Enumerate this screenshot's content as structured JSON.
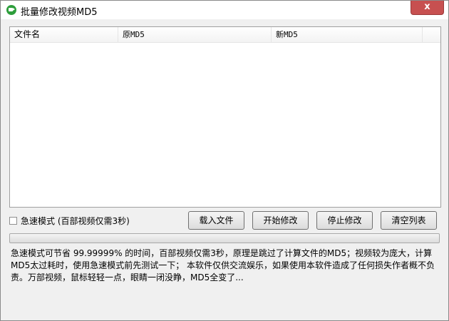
{
  "window": {
    "title": "批量修改视频MD5",
    "close_label": "x"
  },
  "list": {
    "columns": [
      "文件名",
      "原MD5",
      "新MD5",
      ""
    ]
  },
  "fast_mode": {
    "label": "急速模式 (百部视频仅需3秒)",
    "checked": false
  },
  "buttons": {
    "load": "载入文件",
    "start": "开始修改",
    "stop": "停止修改",
    "clear": "清空列表"
  },
  "progress": {
    "fraction": 0
  },
  "description": {
    "line1": "急速模式可节省 99.99999% 的时间，百部视频仅需3秒，原理是跳过了计算文件的MD5；视频较为庞大，计算",
    "line2": "MD5太过耗时，使用急速模式前先测试一下；  本软件仅供交流娱乐，如果使用本软件造成了任何损失作者概不负",
    "line3": "责。万部视频，鼠标轻轻一点，眼睛一闭没睁，MD5全变了..."
  },
  "colors": {
    "close_button": "#c75050",
    "progress_fill": "#3fb34f",
    "icon": "#2e9e3c"
  }
}
